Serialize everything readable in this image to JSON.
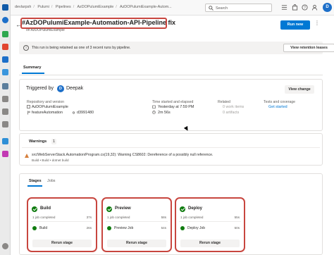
{
  "topbar": {
    "breadcrumbs": [
      "devlarpsh",
      "Pulumi",
      "Pipelines",
      "AzDOPulumiExample",
      "AzDOPulumiExample-Autom..."
    ],
    "search_placeholder": "Search",
    "user_initial": "D"
  },
  "header": {
    "title": "#AzDOPulumiExample-Automation-API-Pipeline fix",
    "subtitle": "on AzDOPulumiExample",
    "run_new_label": "Run new",
    "more_label": "⋮"
  },
  "banner": {
    "text": "This run is being retained as one of 3 recent runs by pipeline.",
    "button_label": "View retention leases"
  },
  "tabs": {
    "summary": "Summary"
  },
  "summary": {
    "triggered_by_label": "Triggered by",
    "trigger_user_initial": "D",
    "trigger_user": "Deepak",
    "view_change_label": "View change",
    "repo_label": "Repository and version",
    "repo_name": "AzDOPulumiExample",
    "branch": "featureAutomation",
    "commit": "d3991480",
    "time_label": "Time started and elapsed",
    "time_started": "Yesterday at 7:59 PM",
    "elapsed": "2m 56s",
    "related_label": "Related",
    "work_items": "0 work items",
    "artifacts": "0 artifacts",
    "tests_label": "Tests and coverage",
    "tests_link": "Get started"
  },
  "warnings": {
    "title": "Warnings",
    "count": "1",
    "message": "src/WebServerStack.Automation/Program.cs(19,32): Warning CS8602: Dereference of a possibly null reference.",
    "source": "Build • Build • dotnet build"
  },
  "stages_tabs": {
    "stages": "Stages",
    "jobs": "Jobs"
  },
  "stages": [
    {
      "name": "Build",
      "jobs": "1 job completed",
      "time": "37s",
      "job_name": "Build",
      "job_time": "26s",
      "rerun_label": "Rerun stage"
    },
    {
      "name": "Preview",
      "jobs": "1 job completed",
      "time": "58s",
      "job_name": "Preview Job",
      "job_time": "54s",
      "rerun_label": "Rerun stage"
    },
    {
      "name": "Deploy",
      "jobs": "1 job completed",
      "time": "55s",
      "job_name": "Deploy Job",
      "job_time": "50s",
      "rerun_label": "Rerun stage"
    }
  ],
  "colors": {
    "accent": "#0078d4",
    "success": "#107c10",
    "highlight": "#c8463f",
    "warning": "#d67f3c"
  }
}
